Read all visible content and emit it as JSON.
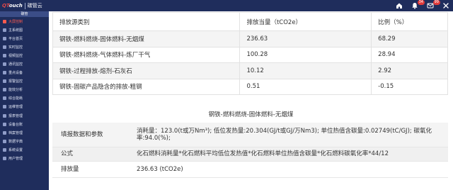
{
  "app": {
    "logo_brand_left": "QT",
    "logo_brand_right": "ouch",
    "logo_title": "碳管云"
  },
  "topbar": {
    "icons": [
      "home-icon",
      "bell-icon",
      "message-icon",
      "close-icon"
    ],
    "badges": {
      "bell": "34",
      "message": "99"
    }
  },
  "sidebar": {
    "header": "碳管",
    "items": [
      {
        "label": "大屏控制",
        "active": true
      },
      {
        "label": "主系统图",
        "active": false
      },
      {
        "label": "平台首页",
        "active": false
      },
      {
        "label": "实时监控",
        "active": false
      },
      {
        "label": "视频监控",
        "active": false
      },
      {
        "label": "通讯监控",
        "active": false
      },
      {
        "label": "重点设备",
        "active": false
      },
      {
        "label": "报警监控",
        "active": false
      },
      {
        "label": "能效分析",
        "active": false
      },
      {
        "label": "综合能耗",
        "active": false
      },
      {
        "label": "运维管理",
        "active": false
      },
      {
        "label": "报表管理",
        "active": false
      },
      {
        "label": "设备台账",
        "active": false
      },
      {
        "label": "档案管理",
        "active": false
      },
      {
        "label": "数据字典",
        "active": false
      },
      {
        "label": "系统设置",
        "active": false
      },
      {
        "label": "用户管理",
        "active": false
      }
    ]
  },
  "summary_table": {
    "headers": [
      "排放源类别",
      "排放当量（tCO2e）",
      "比例（%）"
    ],
    "rows": [
      [
        "钢铁-燃料燃烧-固体燃料-无烟煤",
        "236.63",
        "68.29"
      ],
      [
        "钢铁-燃料燃烧-气体燃料-炼厂干气",
        "100.28",
        "28.94"
      ],
      [
        "钢铁-过程排放-熔剂-石灰石",
        "10.12",
        "2.92"
      ],
      [
        "钢铁-固碳产品隐含的排放-粗钢",
        "0.51",
        "-0.15"
      ]
    ]
  },
  "detail": {
    "title": "钢铁-燃料燃烧-固体燃料-无烟煤",
    "rows": [
      {
        "label": "填报数据和参数",
        "value": "消耗量：123.0(t或万Nm³); 低位发热量:20.304(GJ/t或GJ/万Nm3); 单位热值含碳量:0.02749(tC/GJ); 碳氧化率:94.0(%);"
      },
      {
        "label": "公式",
        "value": "化石燃料消耗量*化石燃料平均低位发热值*化石燃料单位热值含碳量*化石燃料碳氧化率*44/12"
      },
      {
        "label": "排放量",
        "value": "236.63 (tCO2e)"
      }
    ]
  }
}
